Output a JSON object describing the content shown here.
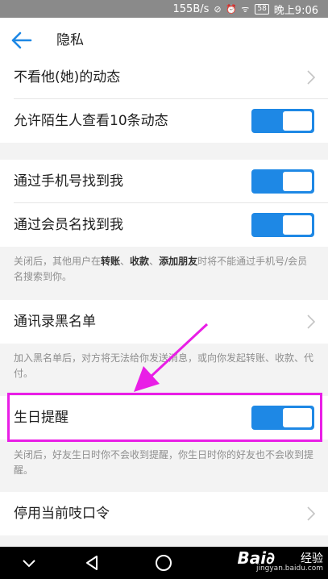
{
  "status_bar": {
    "speed": "155B/s",
    "icons": "⊘ ⏰ ᯤ",
    "battery": "58",
    "time": "晚上9:06"
  },
  "header": {
    "title": "隐私"
  },
  "rows": {
    "hide_feed": "不看他(她)的动态",
    "stranger_view": "允许陌生人查看10条动态",
    "find_by_phone": "通过手机号找到我",
    "find_by_member": "通过会员名找到我",
    "blacklist": "通讯录黑名单",
    "birthday": "生日提醒",
    "password": "停用当前吱口令"
  },
  "toggles": {
    "stranger_view": true,
    "find_by_phone": true,
    "find_by_member": true,
    "birthday": true
  },
  "notes": {
    "find_note_part1": "关闭后，其他用户在",
    "find_note_bold1": "转账",
    "find_note_sep1": "、",
    "find_note_bold2": "收款",
    "find_note_sep2": "、",
    "find_note_bold3": "添加朋友",
    "find_note_part2": "时将不能通过手机号/会员名搜索到你。",
    "blacklist_note": "加入黑名单后，对方将无法给你发送消息，或向你发起转账、收款、代付。",
    "birthday_note": "关闭后，好友生日时你不会收到提醒，你生日时你的好友也不会收到提醒。"
  },
  "watermark": {
    "logo": "Bai∂",
    "brand": "经验",
    "url": "jingyan.baidu.com"
  },
  "colors": {
    "accent": "#1e88e5",
    "highlight": "#e91ee6",
    "background": "#f3f3f3"
  }
}
